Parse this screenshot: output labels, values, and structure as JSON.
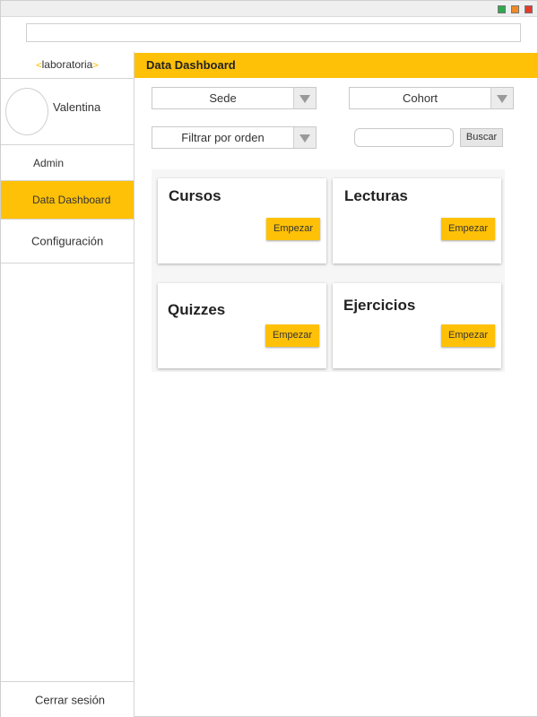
{
  "window": {
    "controls": [
      "minimize-icon",
      "maximize-icon",
      "close-icon"
    ],
    "control_colors": [
      "#2fa84f",
      "#f08a24",
      "#e23b2e"
    ]
  },
  "address_bar": {
    "value": ""
  },
  "sidebar": {
    "logo": {
      "open": "<",
      "text": "laboratoria",
      "close": ">"
    },
    "user": {
      "name": "Valentina"
    },
    "items": [
      {
        "label": "Admin"
      },
      {
        "label": "Data Dashboard",
        "active": true
      },
      {
        "label": "Configuración"
      }
    ],
    "logout_label": "Cerrar sesión"
  },
  "header": {
    "title": "Data Dashboard",
    "color": "#ffc107"
  },
  "filters": {
    "sede": {
      "label": "Sede"
    },
    "cohort": {
      "label": "Cohort"
    },
    "orden": {
      "label": "Filtrar por orden"
    },
    "search": {
      "value": "",
      "button_label": "Buscar"
    }
  },
  "cards": [
    {
      "title": "Cursos",
      "button": "Empezar"
    },
    {
      "title": "Lecturas",
      "button": "Empezar"
    },
    {
      "title": "Quizzes",
      "button": "Empezar"
    },
    {
      "title": "Ejercicios",
      "button": "Empezar"
    }
  ]
}
